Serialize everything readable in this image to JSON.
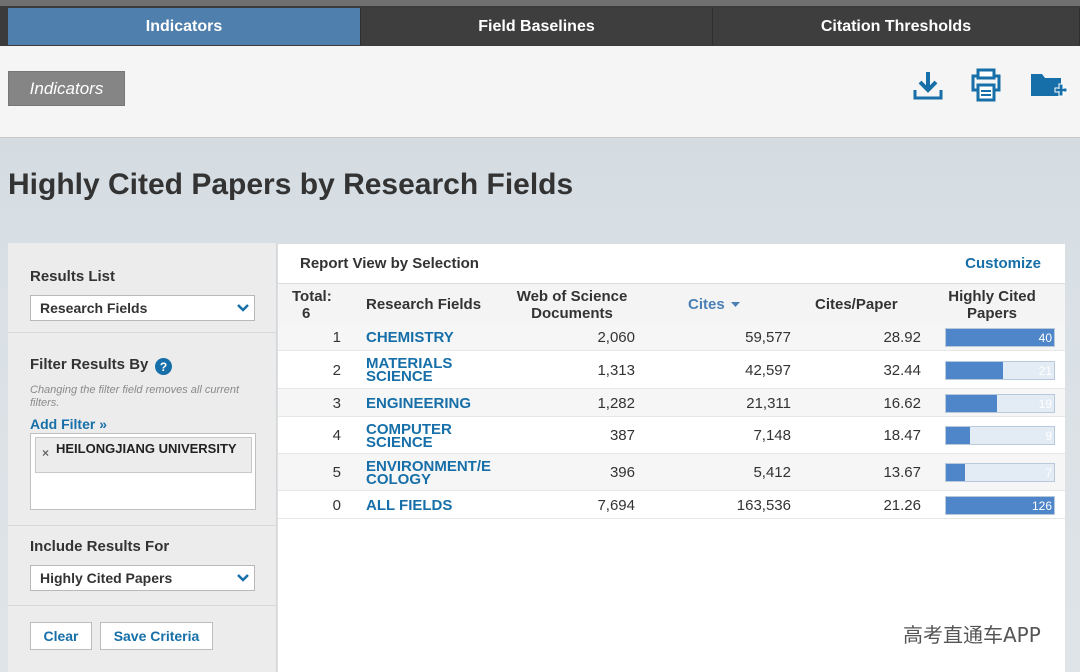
{
  "tabs": [
    {
      "label": "Indicators",
      "active": true
    },
    {
      "label": "Field Baselines",
      "active": false
    },
    {
      "label": "Citation Thresholds",
      "active": false
    }
  ],
  "toolbar": {
    "indicators_label": "Indicators",
    "icons": [
      "download-icon",
      "print-icon",
      "add-folder-icon"
    ]
  },
  "page_title": "Highly Cited Papers by Research Fields",
  "left_panel": {
    "results_list_label": "Results List",
    "results_list_value": "Research Fields",
    "filter_label": "Filter Results By",
    "help_glyph": "?",
    "filter_hint": "Changing the filter field removes all current filters.",
    "add_filter": "Add Filter »",
    "filter_chip": "HEILONGJIANG UNIVERSITY",
    "chip_remove": "×",
    "include_label": "Include Results For",
    "include_value": "Highly Cited Papers",
    "clear_button": "Clear",
    "save_button": "Save Criteria"
  },
  "report": {
    "title": "Report View by Selection",
    "customize": "Customize",
    "headers": {
      "total": "Total:",
      "total_count": "6",
      "field": "Research Fields",
      "wos": "Web of Science Documents",
      "cites": "Cites",
      "cites_paper": "Cites/Paper",
      "hcp": "Highly Cited Papers"
    },
    "rows": [
      {
        "rank": "1",
        "field": "CHEMISTRY",
        "wos": "2,060",
        "cites": "59,577",
        "cpp": "28.92",
        "hcp": "40",
        "hcp_fraction": 1.0
      },
      {
        "rank": "2",
        "field": "MATERIALS SCIENCE",
        "wos": "1,313",
        "cites": "42,597",
        "cpp": "32.44",
        "hcp": "21",
        "hcp_fraction": 0.525
      },
      {
        "rank": "3",
        "field": "ENGINEERING",
        "wos": "1,282",
        "cites": "21,311",
        "cpp": "16.62",
        "hcp": "19",
        "hcp_fraction": 0.475
      },
      {
        "rank": "4",
        "field": "COMPUTER SCIENCE",
        "wos": "387",
        "cites": "7,148",
        "cpp": "18.47",
        "hcp": "9",
        "hcp_fraction": 0.225
      },
      {
        "rank": "5",
        "field": "ENVIRONMENT/E COLOGY",
        "wos": "396",
        "cites": "5,412",
        "cpp": "13.67",
        "hcp": "7",
        "hcp_fraction": 0.175
      },
      {
        "rank": "0",
        "field": "ALL FIELDS",
        "wos": "7,694",
        "cites": "163,536",
        "cpp": "21.26",
        "hcp": "126",
        "hcp_fraction": 1.0
      }
    ]
  },
  "watermark": "高考直通车APP",
  "colors": {
    "active_tab": "#4f7fac",
    "link": "#166fa8",
    "bar_fill": "#4e86c9"
  }
}
